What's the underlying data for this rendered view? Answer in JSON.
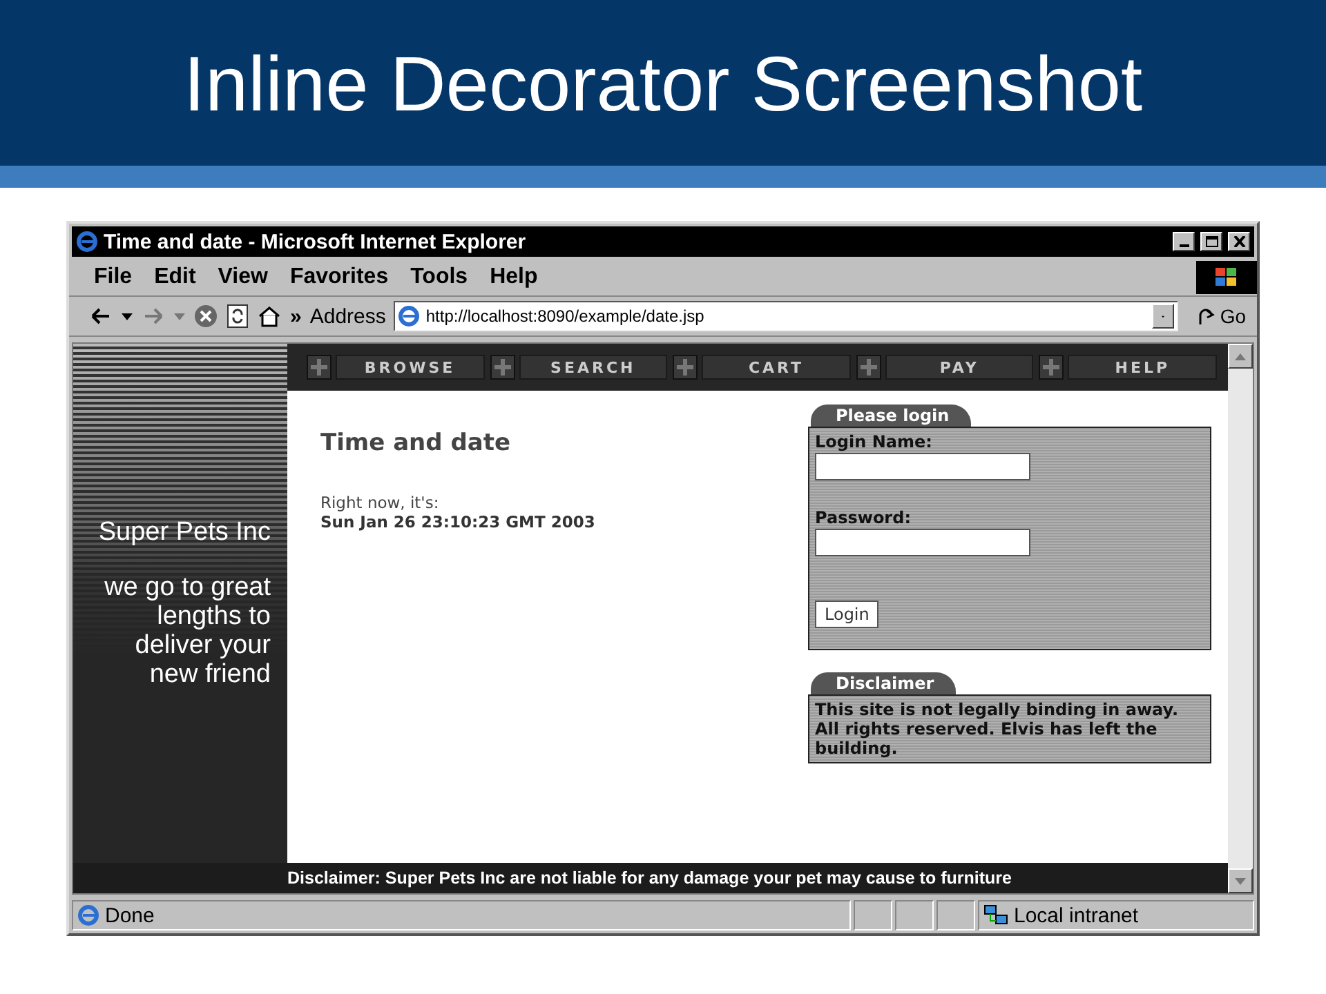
{
  "slide_title": "Inline Decorator Screenshot",
  "window": {
    "title": "Time and date - Microsoft Internet Explorer"
  },
  "menu": [
    "File",
    "Edit",
    "View",
    "Favorites",
    "Tools",
    "Help"
  ],
  "toolbar": {
    "chevron": "»",
    "address_label": "Address",
    "url": "http://localhost:8090/example/date.jsp",
    "go": "Go"
  },
  "nav": [
    "BROWSE",
    "SEARCH",
    "CART",
    "PAY",
    "HELP"
  ],
  "sidebar": {
    "company": "Super Pets Inc",
    "tagline": "we go to great lengths to deliver your new friend"
  },
  "page": {
    "heading": "Time and date",
    "intro": "Right now, it's:",
    "datetime": "Sun Jan 26 23:10:23 GMT 2003"
  },
  "login": {
    "title": "Please login",
    "fields": [
      {
        "label": "Login Name:"
      },
      {
        "label": "Password:"
      }
    ],
    "button": "Login"
  },
  "disclaimer": {
    "title": "Disclaimer",
    "lines": [
      "This site is not legally binding in away.",
      "All rights reserved. Elvis has left the building."
    ]
  },
  "footer": "Disclaimer: Super Pets Inc are not liable for any damage your pet may cause to furniture",
  "status_bar": {
    "text": "Done",
    "zone": "Local intranet"
  }
}
